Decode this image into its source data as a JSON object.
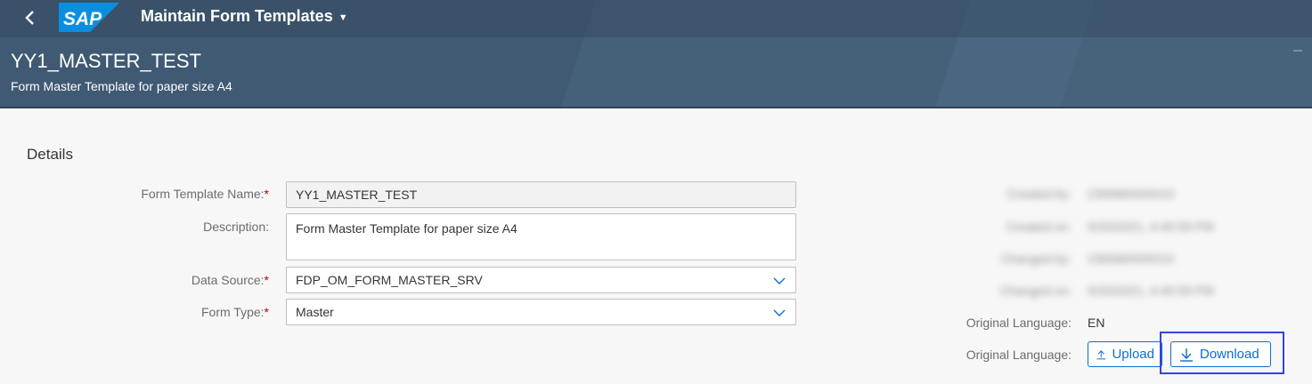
{
  "shell": {
    "logo_text": "SAP",
    "app_title": "Maintain Form Templates",
    "object_title": "YY1_MASTER_TEST",
    "object_subtitle": "Form Master Template for paper size A4"
  },
  "details": {
    "section_title": "Details",
    "form_template_name": {
      "label": "Form Template Name:",
      "required_mark": "*",
      "value": "YY1_MASTER_TEST"
    },
    "description": {
      "label": "Description:",
      "value": "Form Master Template for paper size A4"
    },
    "data_source": {
      "label": "Data Source:",
      "required_mark": "*",
      "value": "FDP_OM_FORM_MASTER_SRV"
    },
    "form_type": {
      "label": "Form Type:",
      "required_mark": "*",
      "value": "Master"
    }
  },
  "admin": {
    "created_by": {
      "label": "Created by:",
      "value": "CB9980000010"
    },
    "created_on": {
      "label": "Created on:",
      "value": "5/20/2021, 4:49:58 PM"
    },
    "changed_by": {
      "label": "Changed by:",
      "value": "CB9980000010"
    },
    "changed_on": {
      "label": "Changed on:",
      "value": "5/20/2021, 4:49:58 PM"
    },
    "original_language": {
      "label": "Original Language:",
      "value": "EN"
    },
    "file_actions": {
      "label": "Original Language:",
      "upload_label": "Upload",
      "download_label": "Download"
    }
  },
  "icons": {
    "back": "back-arrow-icon",
    "app_menu": "caret-down-icon",
    "dropdown": "chevron-down-icon",
    "upload": "upload-icon",
    "download": "download-icon"
  },
  "colors": {
    "shell_bg": "#3f5a72",
    "brand_blue": "#0a6ed1",
    "required": "#bb0000",
    "highlight_box": "#3344dd"
  }
}
